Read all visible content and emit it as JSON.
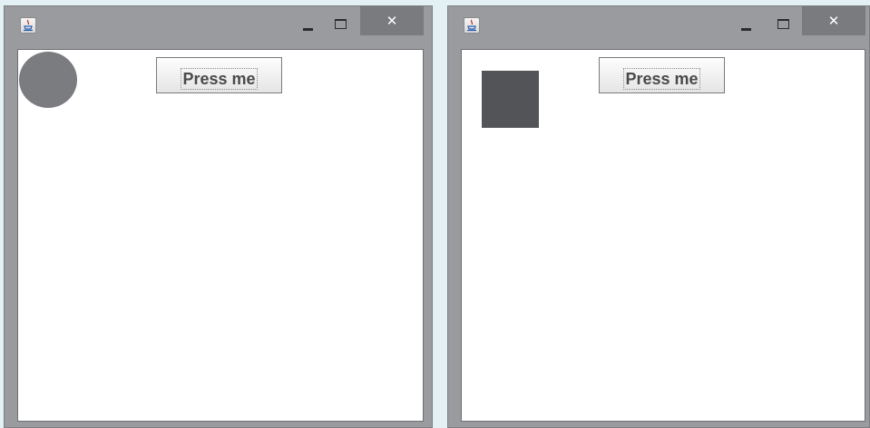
{
  "windows": [
    {
      "button_label": "Press me",
      "close_glyph": "✕",
      "shape": {
        "kind": "circle",
        "color": "#7b7c80"
      }
    },
    {
      "button_label": "Press me",
      "close_glyph": "✕",
      "shape": {
        "kind": "square",
        "color": "#535457"
      }
    }
  ],
  "colors": {
    "desktop_background": "#e3f1f4",
    "window_frame": "#9a9b9f",
    "close_button": "#7a7b7f",
    "content_background": "#ffffff"
  },
  "icons": [
    "java-coffee-icon",
    "minimize-icon",
    "maximize-icon",
    "close-icon"
  ]
}
